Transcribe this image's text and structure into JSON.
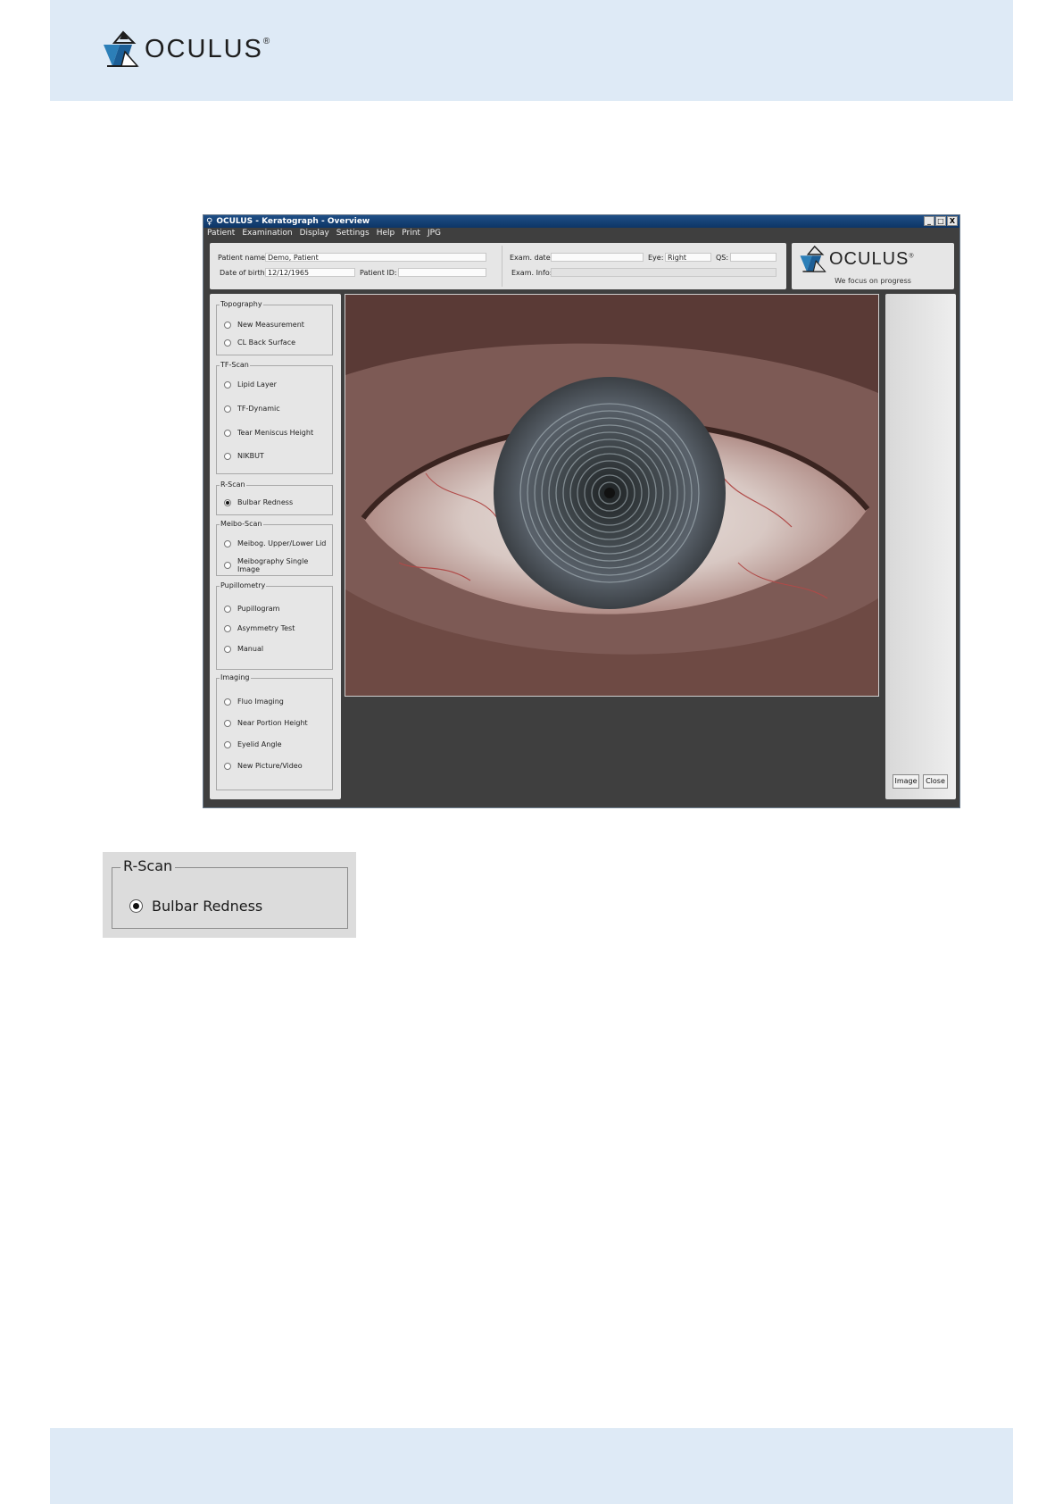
{
  "page": {
    "logo_text": "OCULUS",
    "logo_mark": "®",
    "colors": {
      "header_band": "#deeaf6",
      "titlebar": "#0d3566",
      "window_bg": "#3f3f3f"
    }
  },
  "window": {
    "title": "OCULUS - Keratograph - Overview",
    "controls": {
      "minimize": "_",
      "maximize": "□",
      "close": "X"
    },
    "menu": [
      "Patient",
      "Examination",
      "Display",
      "Settings",
      "Help",
      "Print",
      "JPG"
    ]
  },
  "patient": {
    "name_label": "Patient name:",
    "name_value": "Demo, Patient",
    "dob_label": "Date of birth:",
    "dob_value": "12/12/1965",
    "id_label": "Patient ID:",
    "id_value": "",
    "exam_date_label": "Exam. date:",
    "exam_date_value": "",
    "eye_label": "Eye:",
    "eye_value": "Right",
    "qs_label": "QS:",
    "qs_value": "",
    "exam_info_label": "Exam. Info:",
    "exam_info_value": ""
  },
  "brand_panel": {
    "logo_text": "OCULUS",
    "logo_mark": "®",
    "tagline": "We focus on progress"
  },
  "groups": [
    {
      "title": "Topography",
      "options": [
        {
          "label": "New Measurement",
          "selected": false
        },
        {
          "label": "CL Back Surface",
          "selected": false
        }
      ]
    },
    {
      "title": "TF-Scan",
      "options": [
        {
          "label": "Lipid Layer",
          "selected": false
        },
        {
          "label": "TF-Dynamic",
          "selected": false
        },
        {
          "label": "Tear Meniscus Height",
          "selected": false
        },
        {
          "label": "NIKBUT",
          "selected": false
        }
      ]
    },
    {
      "title": "R-Scan",
      "options": [
        {
          "label": "Bulbar Redness",
          "selected": true
        }
      ]
    },
    {
      "title": "Meibo-Scan",
      "options": [
        {
          "label": "Meibog. Upper/Lower Lid",
          "selected": false
        },
        {
          "label": "Meibography Single Image",
          "selected": false
        }
      ]
    },
    {
      "title": "Pupillometry",
      "options": [
        {
          "label": "Pupillogram",
          "selected": false
        },
        {
          "label": "Asymmetry Test",
          "selected": false
        },
        {
          "label": "Manual",
          "selected": false
        }
      ]
    },
    {
      "title": "Imaging",
      "options": [
        {
          "label": "Fluo Imaging",
          "selected": false
        },
        {
          "label": "Near Portion Height",
          "selected": false
        },
        {
          "label": "Eyelid Angle",
          "selected": false
        },
        {
          "label": "New Picture/Video",
          "selected": false
        }
      ]
    }
  ],
  "buttons": {
    "image": "Image",
    "close": "Close"
  },
  "callout": {
    "title": "R-Scan",
    "option": "Bulbar Redness",
    "selected": true
  }
}
